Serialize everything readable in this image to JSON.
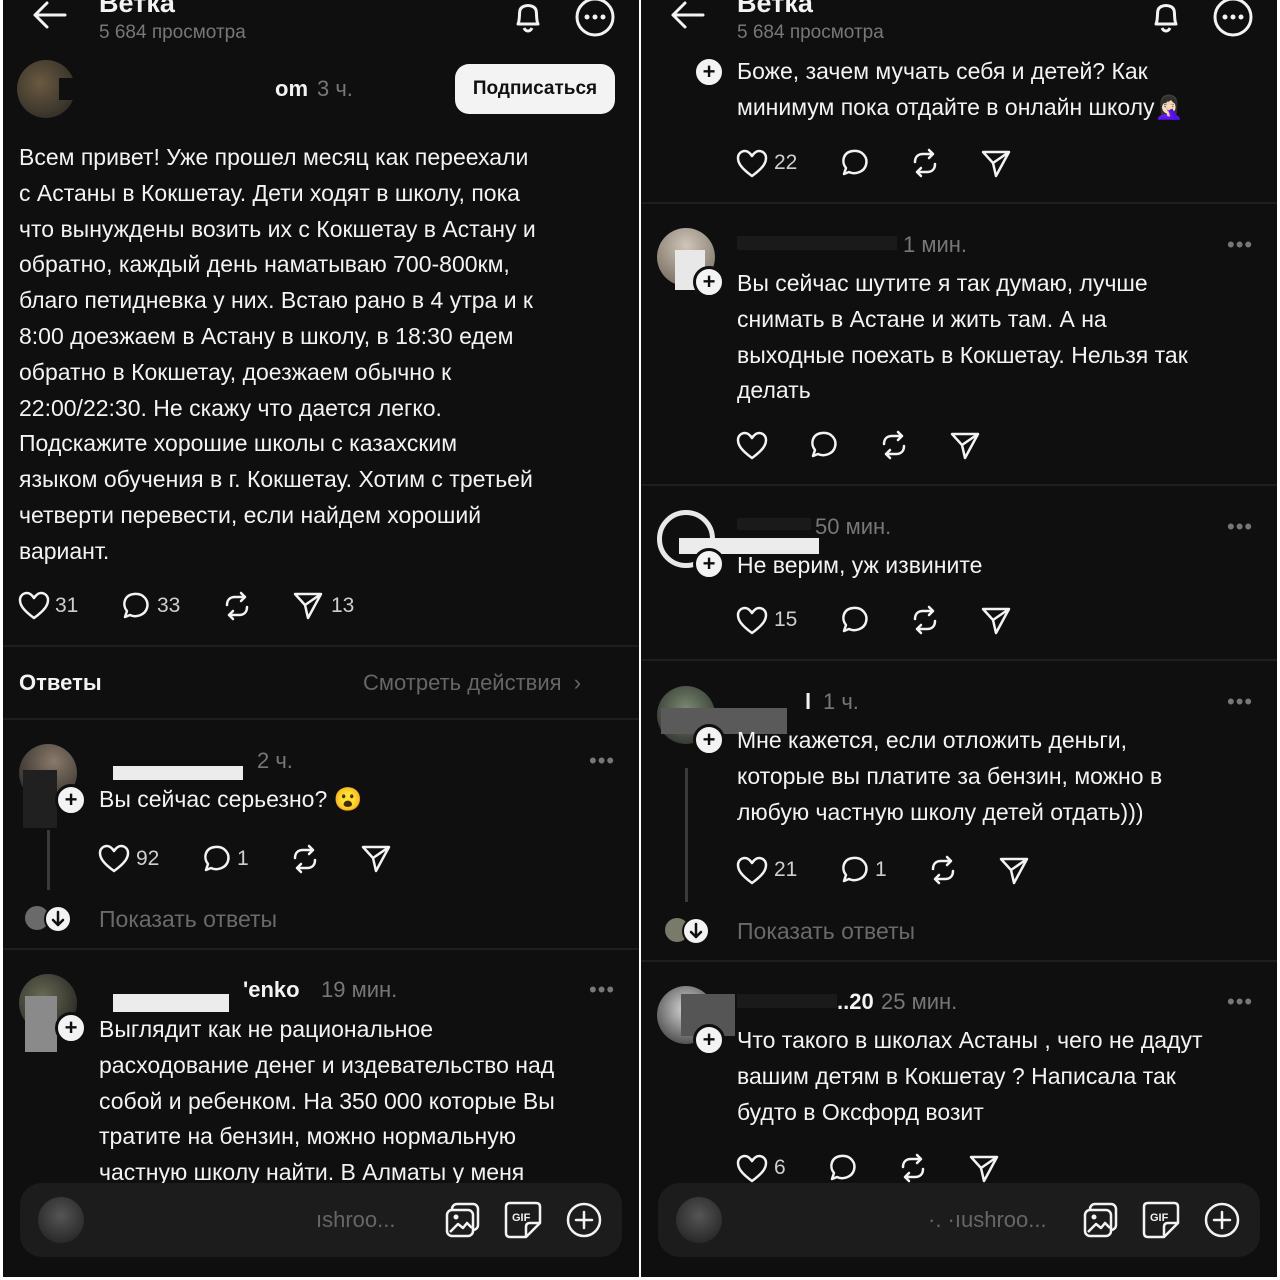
{
  "header": {
    "title": "Ветка",
    "views": "5 684 просмотра"
  },
  "post": {
    "author_suffix": "om",
    "time": "3 ч.",
    "subscribe_label": "Подписаться",
    "lines": [
      "Всем привет! Уже прошел месяц как переехали",
      "с Астаны в Кокшетау. Дети ходят в школу, пока",
      "что вынуждены возить их с Кокшетау в Астану и",
      "обратно, каждый день наматываю 700-800км,",
      "благо петидневка у них. Встаю рано в 4 утра и к",
      "8:00 доезжаем в Астану в школу, в 18:30 едем",
      "обратно в Кокшетау, доезжаем обычно к",
      "22:00/22:30. Не скажу что дается легко.",
      "Подскажите хорошие школы с казахским",
      "языком обучения в г. Кокшетау. Хотим с третьей",
      "четверти перевести, если найдем хороший",
      "вариант."
    ],
    "likes": "31",
    "comments": "33",
    "shares": "13"
  },
  "answers": {
    "label": "Ответы",
    "view_activity": "Смотреть действия",
    "chevron": "›"
  },
  "left_replies": [
    {
      "author_suffix": "",
      "time": "2 ч.",
      "lines": [
        "Вы сейчас серьезно? 😮"
      ],
      "likes": "92",
      "comments": "1",
      "show_replies": "Показать ответы"
    },
    {
      "author_suffix": "'enko",
      "time": "19 мин.",
      "lines": [
        "Выглядит как не рациональное",
        "расходование денег и издевательство над",
        "собой и ребенком. На 350 000 которые Вы",
        "тратите на бензин, можно нормальную",
        "частную школу найти. В Алматы у меня"
      ]
    }
  ],
  "right_replies": [
    {
      "lines": [
        "Боже, зачем мучать себя и детей? Как",
        "минимум пока отдайте в онлайн школу🤦🏻‍♀️"
      ],
      "likes": "22"
    },
    {
      "time": "1 мин.",
      "lines": [
        "Вы сейчас шутите я так думаю, лучше",
        "снимать в Астане и жить там. А на",
        "выходные поехать в Кокшетау. Нельзя так",
        "делать"
      ]
    },
    {
      "time": "50 мин.",
      "lines": [
        "Не верим, уж извините"
      ],
      "likes": "15"
    },
    {
      "author_suffix": "l",
      "time": "1 ч.",
      "lines": [
        "Мне кажется, если отложить деньги,",
        "которые вы платите за бензин, можно в",
        "любую частную школу детей отдать)))"
      ],
      "likes": "21",
      "comments": "1",
      "show_replies": "Показать ответы"
    },
    {
      "author_suffix": "..20",
      "time": "25 мин.",
      "lines": [
        "Что такого в школах Астаны , чего не дадут",
        "вашим детям в Кокшетау ? Написала так",
        "будто в Оксфорд возит"
      ],
      "likes": "6"
    }
  ],
  "reply_bar": {
    "left_placeholder": "ıshroo...",
    "right_placeholder": "·. ·ıushroo..."
  },
  "more_glyph": "•••",
  "plus_glyph": "+",
  "icons": [
    "back-arrow-icon",
    "bell-icon",
    "more-icon",
    "heart-icon",
    "comment-icon",
    "repost-icon",
    "send-icon",
    "image-icon",
    "gif-icon",
    "add-icon",
    "arrow-down-icon"
  ]
}
